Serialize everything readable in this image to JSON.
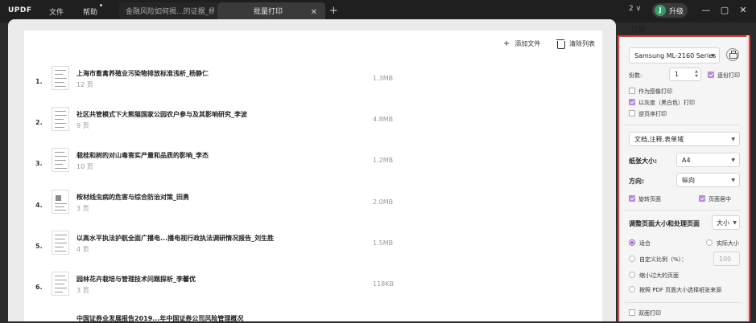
{
  "app": {
    "logo": "UPDF"
  },
  "menu": {
    "file": "文件",
    "help": "帮助"
  },
  "tabs": [
    {
      "label": "金融风险如何揭...的证据_杨强强"
    },
    {
      "label": "批量打印"
    }
  ],
  "window": {
    "count": "2",
    "avatar": "J",
    "upgrade": "升级"
  },
  "toolbar": {
    "add_file": "添加文件",
    "clear_list": "清除列表"
  },
  "files": [
    {
      "index": "1.",
      "title": "上海市畜禽养殖业污染物排放标准浅析_杨静仁",
      "pages": "12 页",
      "size": "1.3MB"
    },
    {
      "index": "2.",
      "title": "社区共管模式下大熊猫国家公园农户参与及其影响研究_李波",
      "pages": "9 页",
      "size": "4.8MB"
    },
    {
      "index": "3.",
      "title": "栽桂和树的对山毒害实产量和品质的影响_李杰",
      "pages": "10 页",
      "size": "1.2MB"
    },
    {
      "index": "4.",
      "title": "桉材线虫病的危害与综合防治对策_田勇",
      "pages": "3 页",
      "size": "2.0MB"
    },
    {
      "index": "5.",
      "title": "以高水平执法护航全面广播电...播电视行政执法调研情况报告_刘生胜",
      "pages": "4 页",
      "size": "1.5MB"
    },
    {
      "index": "6.",
      "title": "园林花卉栽培与管理技术问题探析_李馨优",
      "pages": "3 页",
      "size": "118KB"
    },
    {
      "index": "7.",
      "title": "中国证券业发展报告2019...年中国证券公司风险管理概况",
      "pages": "",
      "size": ""
    }
  ],
  "print_panel": {
    "header": "打印",
    "printer": "Samsung ML-2160 Series",
    "copies_label": "份数:",
    "copies_value": "1",
    "collate": "逐份打印",
    "as_image": "作为图像打印",
    "grayscale": "以灰度（黑白色）打印",
    "reverse": "逆页序打印",
    "content": "文档,注释,表单域",
    "paper_size_label": "纸张大小:",
    "paper_size": "A4",
    "orientation_label": "方向:",
    "orientation": "纵向",
    "auto_rotate": "旋转页面",
    "auto_center": "页面居中",
    "scaling_header": "调整页面大小和处理页面",
    "scaling_mode": "大小",
    "fit": "适合",
    "actual_size": "实际大小",
    "custom_scale": "自定义比例（%）：",
    "custom_scale_value": "100",
    "shrink": "缩小过大的页面",
    "pdf_paper": "按照 PDF 页面大小选择纸张来源",
    "duplex": "双面打印"
  },
  "colors": {
    "accent": "#9b6bd6",
    "highlight_border": "#e53e3e"
  }
}
